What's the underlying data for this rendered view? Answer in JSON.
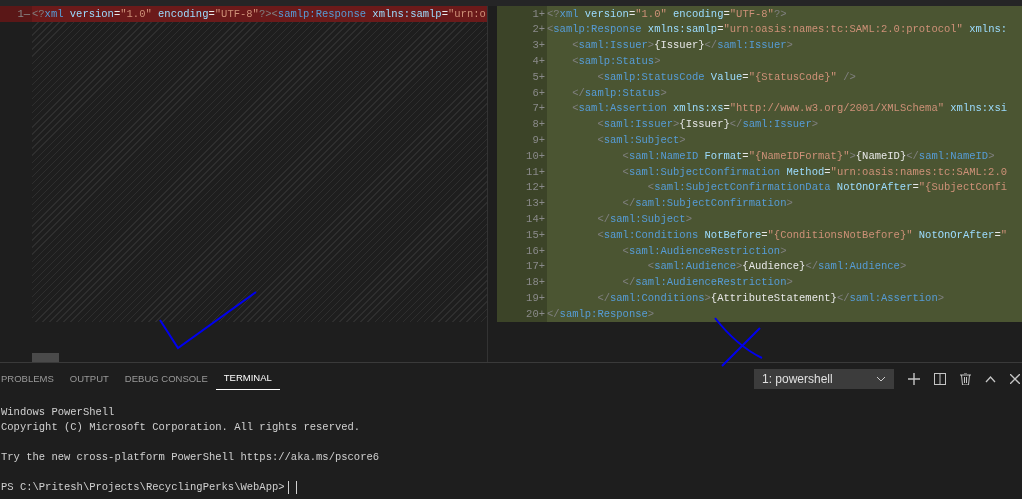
{
  "editor": {
    "left_pane": {
      "lines": [
        {
          "number": "1",
          "marker": "—",
          "kind": "removed",
          "tokens": [
            {
              "kind": "p",
              "text": "<?"
            },
            {
              "kind": "tag",
              "text": "xml"
            },
            {
              "kind": "attr",
              "text": " version"
            },
            {
              "kind": "text",
              "text": "="
            },
            {
              "kind": "str",
              "text": "\"1.0\""
            },
            {
              "kind": "attr",
              "text": " encoding"
            },
            {
              "kind": "text",
              "text": "="
            },
            {
              "kind": "str",
              "text": "\"UTF-8\""
            },
            {
              "kind": "p",
              "text": "?>"
            },
            {
              "kind": "p",
              "text": "<"
            },
            {
              "kind": "tag",
              "text": "samlp:Response"
            },
            {
              "kind": "attr",
              "text": " xmlns:samlp"
            },
            {
              "kind": "text",
              "text": "="
            },
            {
              "kind": "str",
              "text": "\"urn:o"
            }
          ]
        }
      ]
    },
    "right_pane": {
      "lines": [
        {
          "number": "1",
          "marker": "+",
          "kind": "added",
          "tokens": [
            {
              "kind": "p",
              "text": "<?"
            },
            {
              "kind": "tag",
              "text": "xml"
            },
            {
              "kind": "attr",
              "text": " version"
            },
            {
              "kind": "text",
              "text": "="
            },
            {
              "kind": "str",
              "text": "\"1.0\""
            },
            {
              "kind": "attr",
              "text": " encoding"
            },
            {
              "kind": "text",
              "text": "="
            },
            {
              "kind": "str",
              "text": "\"UTF-8\""
            },
            {
              "kind": "p",
              "text": "?>"
            }
          ]
        },
        {
          "number": "2",
          "marker": "+",
          "kind": "added",
          "tokens": [
            {
              "kind": "p",
              "text": "<"
            },
            {
              "kind": "tag",
              "text": "samlp:Response"
            },
            {
              "kind": "attr",
              "text": " xmlns:samlp"
            },
            {
              "kind": "text",
              "text": "="
            },
            {
              "kind": "str",
              "text": "\"urn:oasis:names:tc:SAML:2.0:protocol\""
            },
            {
              "kind": "attr",
              "text": " xmlns:"
            }
          ]
        },
        {
          "number": "3",
          "marker": "+",
          "kind": "added",
          "tokens": [
            {
              "kind": "p",
              "text": "    <"
            },
            {
              "kind": "tag",
              "text": "saml:Issuer"
            },
            {
              "kind": "p",
              "text": ">"
            },
            {
              "kind": "text",
              "text": "{Issuer}"
            },
            {
              "kind": "p",
              "text": "</"
            },
            {
              "kind": "tag",
              "text": "saml:Issuer"
            },
            {
              "kind": "p",
              "text": ">"
            }
          ]
        },
        {
          "number": "4",
          "marker": "+",
          "kind": "added",
          "tokens": [
            {
              "kind": "p",
              "text": "    <"
            },
            {
              "kind": "tag",
              "text": "samlp:Status"
            },
            {
              "kind": "p",
              "text": ">"
            }
          ]
        },
        {
          "number": "5",
          "marker": "+",
          "kind": "added",
          "tokens": [
            {
              "kind": "p",
              "text": "        <"
            },
            {
              "kind": "tag",
              "text": "samlp:StatusCode"
            },
            {
              "kind": "attr",
              "text": " Value"
            },
            {
              "kind": "text",
              "text": "="
            },
            {
              "kind": "str",
              "text": "\"{StatusCode}\""
            },
            {
              "kind": "p",
              "text": " />"
            }
          ]
        },
        {
          "number": "6",
          "marker": "+",
          "kind": "added",
          "tokens": [
            {
              "kind": "p",
              "text": "    </"
            },
            {
              "kind": "tag",
              "text": "samlp:Status"
            },
            {
              "kind": "p",
              "text": ">"
            }
          ]
        },
        {
          "number": "7",
          "marker": "+",
          "kind": "added",
          "tokens": [
            {
              "kind": "p",
              "text": "    <"
            },
            {
              "kind": "tag",
              "text": "saml:Assertion"
            },
            {
              "kind": "attr",
              "text": " xmlns:xs"
            },
            {
              "kind": "text",
              "text": "="
            },
            {
              "kind": "str",
              "text": "\"http://www.w3.org/2001/XMLSchema\""
            },
            {
              "kind": "attr",
              "text": " xmlns:xsi"
            }
          ]
        },
        {
          "number": "8",
          "marker": "+",
          "kind": "added",
          "tokens": [
            {
              "kind": "p",
              "text": "        <"
            },
            {
              "kind": "tag",
              "text": "saml:Issuer"
            },
            {
              "kind": "p",
              "text": ">"
            },
            {
              "kind": "text",
              "text": "{Issuer}"
            },
            {
              "kind": "p",
              "text": "</"
            },
            {
              "kind": "tag",
              "text": "saml:Issuer"
            },
            {
              "kind": "p",
              "text": ">"
            }
          ]
        },
        {
          "number": "9",
          "marker": "+",
          "kind": "added",
          "tokens": [
            {
              "kind": "p",
              "text": "        <"
            },
            {
              "kind": "tag",
              "text": "saml:Subject"
            },
            {
              "kind": "p",
              "text": ">"
            }
          ]
        },
        {
          "number": "10",
          "marker": "+",
          "kind": "added",
          "tokens": [
            {
              "kind": "p",
              "text": "            <"
            },
            {
              "kind": "tag",
              "text": "saml:NameID"
            },
            {
              "kind": "attr",
              "text": " Format"
            },
            {
              "kind": "text",
              "text": "="
            },
            {
              "kind": "str",
              "text": "\"{NameIDFormat}\""
            },
            {
              "kind": "p",
              "text": ">"
            },
            {
              "kind": "text",
              "text": "{NameID}"
            },
            {
              "kind": "p",
              "text": "</"
            },
            {
              "kind": "tag",
              "text": "saml:NameID"
            },
            {
              "kind": "p",
              "text": ">"
            }
          ]
        },
        {
          "number": "11",
          "marker": "+",
          "kind": "added",
          "tokens": [
            {
              "kind": "p",
              "text": "            <"
            },
            {
              "kind": "tag",
              "text": "saml:SubjectConfirmation"
            },
            {
              "kind": "attr",
              "text": " Method"
            },
            {
              "kind": "text",
              "text": "="
            },
            {
              "kind": "str",
              "text": "\"urn:oasis:names:tc:SAML:2.0"
            }
          ]
        },
        {
          "number": "12",
          "marker": "+",
          "kind": "added",
          "tokens": [
            {
              "kind": "p",
              "text": "                <"
            },
            {
              "kind": "tag",
              "text": "saml:SubjectConfirmationData"
            },
            {
              "kind": "attr",
              "text": " NotOnOrAfter"
            },
            {
              "kind": "text",
              "text": "="
            },
            {
              "kind": "str",
              "text": "\"{SubjectConfi"
            }
          ]
        },
        {
          "number": "13",
          "marker": "+",
          "kind": "added",
          "tokens": [
            {
              "kind": "p",
              "text": "            </"
            },
            {
              "kind": "tag",
              "text": "saml:SubjectConfirmation"
            },
            {
              "kind": "p",
              "text": ">"
            }
          ]
        },
        {
          "number": "14",
          "marker": "+",
          "kind": "added",
          "tokens": [
            {
              "kind": "p",
              "text": "        </"
            },
            {
              "kind": "tag",
              "text": "saml:Subject"
            },
            {
              "kind": "p",
              "text": ">"
            }
          ]
        },
        {
          "number": "15",
          "marker": "+",
          "kind": "added",
          "tokens": [
            {
              "kind": "p",
              "text": "        <"
            },
            {
              "kind": "tag",
              "text": "saml:Conditions"
            },
            {
              "kind": "attr",
              "text": " NotBefore"
            },
            {
              "kind": "text",
              "text": "="
            },
            {
              "kind": "str",
              "text": "\"{ConditionsNotBefore}\""
            },
            {
              "kind": "attr",
              "text": " NotOnOrAfter"
            },
            {
              "kind": "text",
              "text": "="
            },
            {
              "kind": "str",
              "text": "\""
            }
          ]
        },
        {
          "number": "16",
          "marker": "+",
          "kind": "added",
          "tokens": [
            {
              "kind": "p",
              "text": "            <"
            },
            {
              "kind": "tag",
              "text": "saml:AudienceRestriction"
            },
            {
              "kind": "p",
              "text": ">"
            }
          ]
        },
        {
          "number": "17",
          "marker": "+",
          "kind": "added",
          "tokens": [
            {
              "kind": "p",
              "text": "                <"
            },
            {
              "kind": "tag",
              "text": "saml:Audience"
            },
            {
              "kind": "p",
              "text": ">"
            },
            {
              "kind": "text",
              "text": "{Audience}"
            },
            {
              "kind": "p",
              "text": "</"
            },
            {
              "kind": "tag",
              "text": "saml:Audience"
            },
            {
              "kind": "p",
              "text": ">"
            }
          ]
        },
        {
          "number": "18",
          "marker": "+",
          "kind": "added",
          "tokens": [
            {
              "kind": "p",
              "text": "            </"
            },
            {
              "kind": "tag",
              "text": "saml:AudienceRestriction"
            },
            {
              "kind": "p",
              "text": ">"
            }
          ]
        },
        {
          "number": "19",
          "marker": "+",
          "kind": "added",
          "tokens": [
            {
              "kind": "p",
              "text": "        </"
            },
            {
              "kind": "tag",
              "text": "saml:Conditions"
            },
            {
              "kind": "p",
              "text": ">"
            },
            {
              "kind": "text",
              "text": "{AttributeStatement}"
            },
            {
              "kind": "p",
              "text": "</"
            },
            {
              "kind": "tag",
              "text": "saml:Assertion"
            },
            {
              "kind": "p",
              "text": ">"
            }
          ]
        },
        {
          "number": "20",
          "marker": "+",
          "kind": "added",
          "tokens": [
            {
              "kind": "p",
              "text": "</"
            },
            {
              "kind": "tag",
              "text": "samlp:Response"
            },
            {
              "kind": "p",
              "text": ">"
            }
          ]
        }
      ]
    }
  },
  "panel": {
    "tabs": [
      {
        "label": "PROBLEMS",
        "selected": false
      },
      {
        "label": "OUTPUT",
        "selected": false
      },
      {
        "label": "DEBUG CONSOLE",
        "selected": false
      },
      {
        "label": "TERMINAL",
        "selected": true
      }
    ],
    "terminal_select": {
      "value": "1: powershell"
    },
    "terminal": {
      "paragraphs": [
        [
          "Windows PowerShell",
          "Copyright (C) Microsoft Corporation. All rights reserved."
        ],
        [
          "Try the new cross-platform PowerShell https://aka.ms/pscore6"
        ]
      ],
      "prompt": "PS C:\\Pritesh\\Projects\\RecyclingPerks\\WebApp>"
    }
  }
}
